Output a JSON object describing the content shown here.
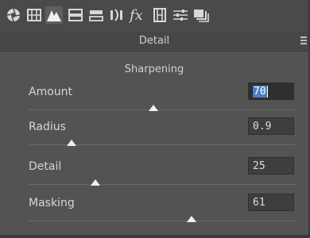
{
  "toolbar": {
    "icons": [
      "aperture-icon",
      "grid-icon",
      "mountain-icon",
      "split-toning-icon",
      "hsl-icon",
      "lens-icon",
      "fx-icon",
      "film-strip-icon",
      "sliders-icon",
      "presets-icon"
    ]
  },
  "panel": {
    "title": "Detail"
  },
  "sharpening": {
    "section_title": "Sharpening",
    "sliders": [
      {
        "label": "Amount",
        "value": "70",
        "min": 0,
        "max": 150,
        "num": 70,
        "active": true
      },
      {
        "label": "Radius",
        "value": "0.9",
        "min": 0.5,
        "max": 3.0,
        "num": 0.9,
        "active": false
      },
      {
        "label": "Detail",
        "value": "25",
        "min": 0,
        "max": 100,
        "num": 25,
        "active": false
      },
      {
        "label": "Masking",
        "value": "61",
        "min": 0,
        "max": 100,
        "num": 61,
        "active": false
      }
    ]
  },
  "colors": {
    "background": "#535353",
    "selection": "#4b7fc3"
  }
}
